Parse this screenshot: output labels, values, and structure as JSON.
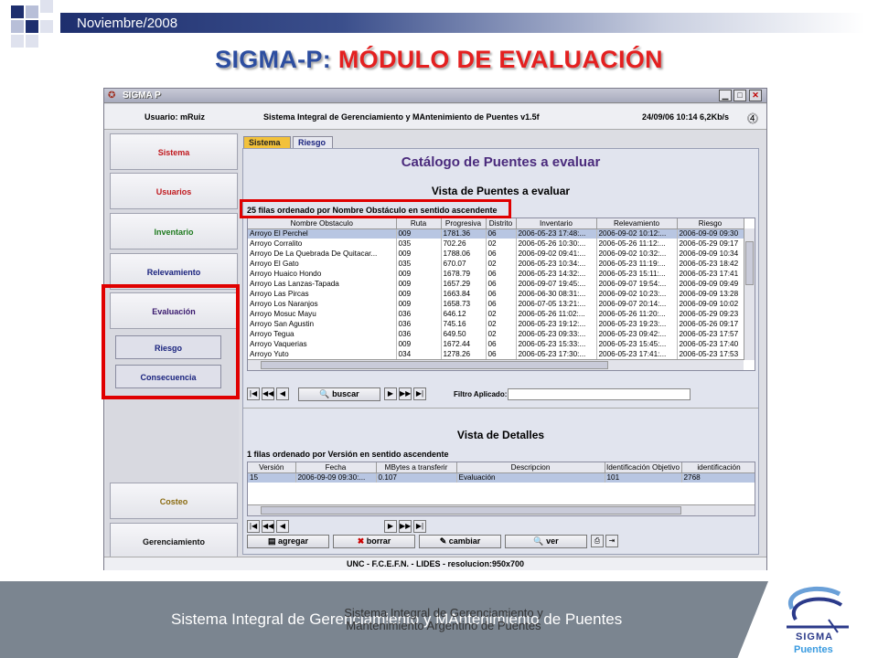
{
  "slide": {
    "date": "Noviembre/2008",
    "title_part1": "SIGMA-P:",
    "title_part2": "MÓDULO DE EVALUACIÓN",
    "footer_text": "Sistema Integral de Gerenciamiento y MAntenimiento de Puentes",
    "overlay_text": "Sistema Integral de Gerenciamiento y Mantenimiento Argentino de Puentes",
    "logo_word1": "SIGMA",
    "logo_word2": "Puentes",
    "colors": {
      "accent_red": "#e00000",
      "title_blue": "#2d4ea0",
      "band_gray": "#7b8590"
    }
  },
  "app": {
    "window_title": "SIGMA P",
    "user": "Usuario: mRuiz",
    "system_title": "Sistema Integral de Gerenciamiento y MAntenimiento de Puentes v1.5f",
    "datetime": "24/09/06 10:14  6,2Kb/s",
    "footer": "UNC - F.C.E.F.N. - LIDES - resolucion:950x700"
  },
  "nav": {
    "sistema": "Sistema",
    "usuarios": "Usuarios",
    "inventario": "Inventario",
    "relevamiento": "Relevamiento",
    "evaluacion": "Evaluación",
    "riesgo": "Riesgo",
    "consecuencia": "Consecuencia",
    "costeo": "Costeo",
    "gerenciamiento": "Gerenciamiento"
  },
  "tabs": {
    "sistema": "Sistema",
    "riesgo": "Riesgo"
  },
  "catalog": {
    "title": "Catálogo de Puentes a evaluar",
    "vista": "Vista de Puentes a evaluar",
    "sort_info": "25 filas ordenado por Nombre Obstáculo en sentido ascendente",
    "buscar": "buscar",
    "filtro_label": "Filtro Aplicado:"
  },
  "table1": {
    "headers": [
      "Nombre Obstaculo",
      "Ruta",
      "Progresiva",
      "Distrito",
      "Inventario",
      "Relevamiento",
      "Riesgo"
    ],
    "rows": [
      [
        "Arroyo  El Perchel",
        "009",
        "1781.36",
        "06",
        "2006-05-23 17:48:...",
        "2006-09-02 10:12:...",
        "2006-09-09 09:30"
      ],
      [
        "Arroyo Corralito",
        "035",
        "702.26",
        "02",
        "2006-05-26 10:30:...",
        "2006-05-26 11:12:...",
        "2006-05-29 09:17"
      ],
      [
        "Arroyo De La Quebrada De Quitacar...",
        "009",
        "1788.06",
        "06",
        "2006-09-02 09:41:...",
        "2006-09-02 10:32:...",
        "2006-09-09 10:34"
      ],
      [
        "Arroyo El Gato",
        "035",
        "670.07",
        "02",
        "2006-05-23 10:34:...",
        "2006-05-23 11:19:...",
        "2006-05-23 18:42"
      ],
      [
        "Arroyo Huaico Hondo",
        "009",
        "1678.79",
        "06",
        "2006-05-23 14:32:...",
        "2006-05-23 15:11:...",
        "2006-05-23 17:41"
      ],
      [
        "Arroyo Las Lanzas-Tapada",
        "009",
        "1657.29",
        "06",
        "2006-09-07 19:45:...",
        "2006-09-07 19:54:...",
        "2006-09-09 09:49"
      ],
      [
        "Arroyo Las Pircas",
        "009",
        "1663.84",
        "06",
        "2006-06-30 08:31:...",
        "2006-09-02 10:23:...",
        "2006-09-09 13:28"
      ],
      [
        "Arroyo Los Naranjos",
        "009",
        "1658.73",
        "06",
        "2006-07-05 13:21:...",
        "2006-09-07 20:14:...",
        "2006-09-09 10:02"
      ],
      [
        "Arroyo Mosuc Mayu",
        "036",
        "646.12",
        "02",
        "2006-05-26 11:02:...",
        "2006-05-26 11:20:...",
        "2006-05-29 09:23"
      ],
      [
        "Arroyo San Agustin",
        "036",
        "745.16",
        "02",
        "2006-05-23 19:12:...",
        "2006-05-23 19:23:...",
        "2006-05-26 09:17"
      ],
      [
        "Arroyo Tegua",
        "036",
        "649.50",
        "02",
        "2006-05-23 09:33:...",
        "2006-05-23 09:42:...",
        "2006-05-23 17:57"
      ],
      [
        "Arroyo Vaquerias",
        "009",
        "1672.44",
        "06",
        "2006-05-23 15:33:...",
        "2006-05-23 15:45:...",
        "2006-05-23 17:40"
      ],
      [
        "Arroyo Yuto",
        "034",
        "1278.26",
        "06",
        "2006-05-23 17:30:...",
        "2006-05-23 17:41:...",
        "2006-05-23 17:53"
      ]
    ]
  },
  "detalles": {
    "title": "Vista de Detalles",
    "sort_info": "1 filas ordenado por Versión en sentido ascendente",
    "headers": [
      "Versión",
      "Fecha",
      "MBytes a transferir",
      "Descripcion",
      "Identificación Objetivo",
      "identificación"
    ],
    "rows": [
      [
        "15",
        "2006-09-09 09:30:...",
        "0.107",
        "Evaluación",
        "101",
        "2768"
      ]
    ]
  },
  "actions": {
    "agregar": "agregar",
    "borrar": "borrar",
    "cambiar": "cambiar",
    "ver": "ver"
  }
}
